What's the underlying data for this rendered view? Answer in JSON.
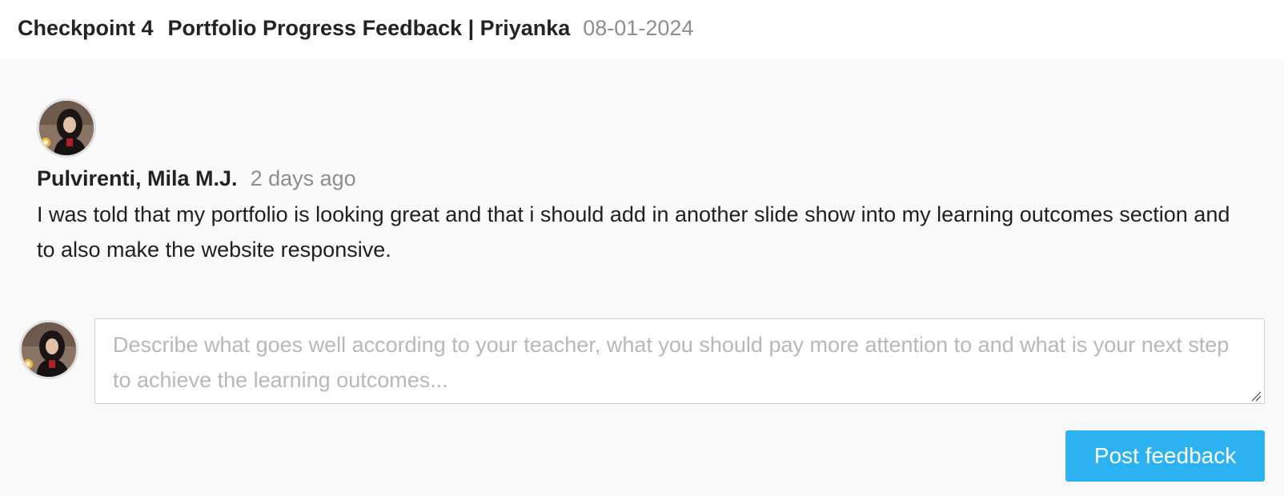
{
  "header": {
    "checkpoint": "Checkpoint 4",
    "title": "Portfolio Progress Feedback | Priyanka",
    "date": "08-01-2024"
  },
  "comment": {
    "author": "Pulvirenti, Mila M.J.",
    "timestamp": "2 days ago",
    "body": "I was told that my portfolio is looking great and that i should add in another slide show into my learning outcomes section and to also make the website responsive."
  },
  "feedback_form": {
    "value": "",
    "placeholder": "Describe what goes well according to your teacher, what you should pay more attention to and what is your next step to achieve the learning outcomes...",
    "submit_label": "Post feedback"
  },
  "colors": {
    "accent": "#2db2f1",
    "muted_text": "#8e8e8e",
    "page_background": "#f9f9f9"
  }
}
